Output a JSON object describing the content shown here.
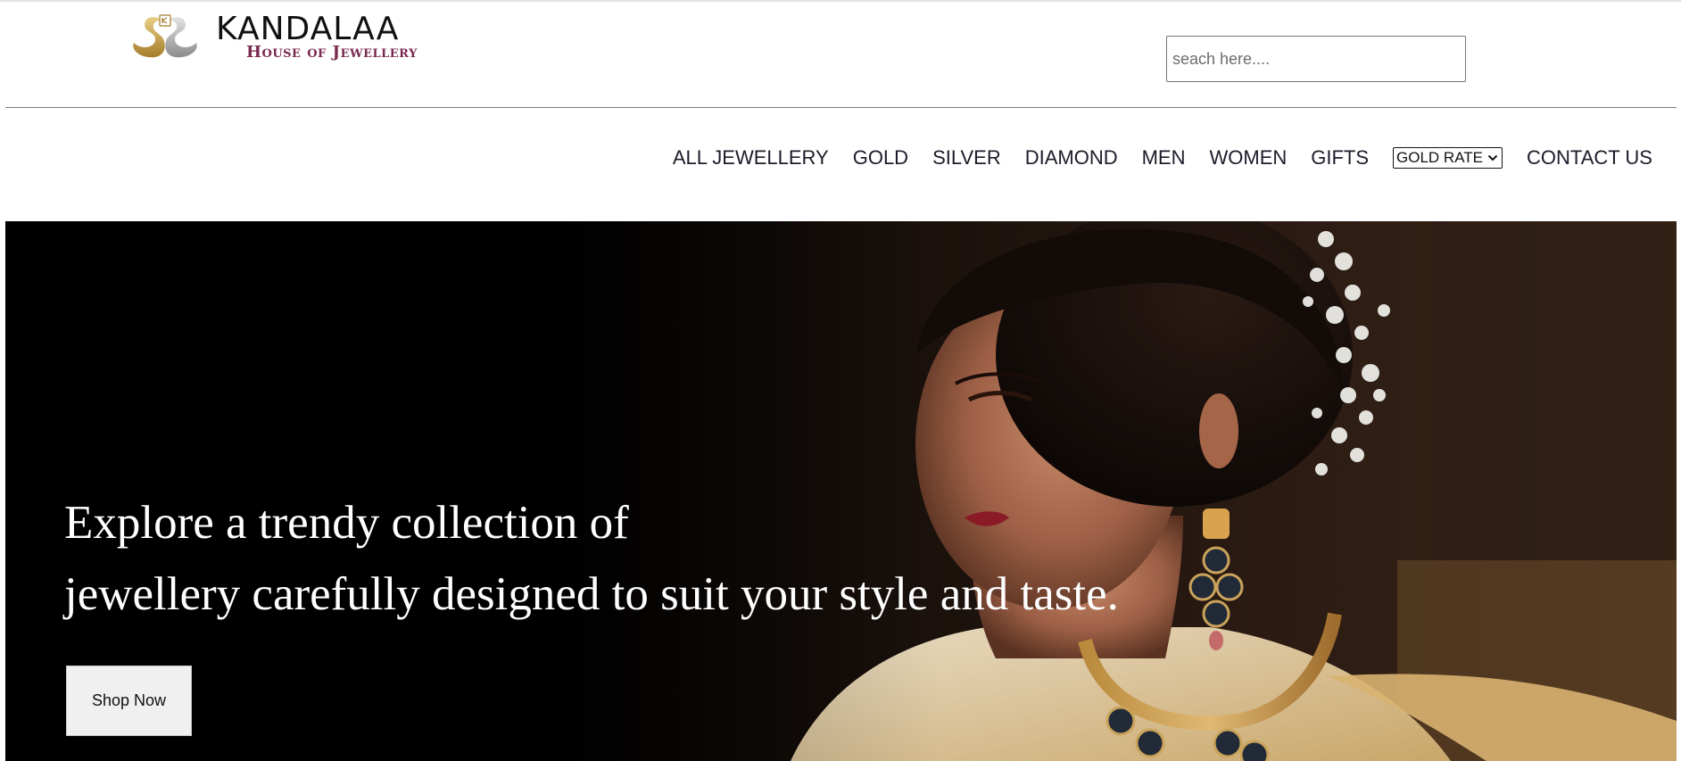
{
  "brand": {
    "name": "KANDALAA",
    "tagline": "House of Jewellery"
  },
  "search": {
    "placeholder": "seach here....",
    "value": ""
  },
  "nav": {
    "items": [
      "ALL JEWELLERY",
      "GOLD",
      "SILVER",
      "DIAMOND",
      "MEN",
      "WOMEN",
      "GIFTS"
    ],
    "gold_rate_label": "GOLD RATE",
    "contact_label": "CONTACT US"
  },
  "hero": {
    "headline_line1": "Explore a trendy collection of",
    "headline_line2": "jewellery carefully designed to suit your style and taste.",
    "cta_label": "Shop Now"
  },
  "colors": {
    "brand_title": "#111111",
    "brand_tagline": "#7a2a50",
    "emblem_gold": "#c9a24a",
    "nav_text": "#1c1c2a",
    "hero_background": "#000000",
    "hero_text": "#ffffff",
    "button_background": "#f0f0f0"
  },
  "icons": {
    "logo": "twin-swan-emblem-icon",
    "dropdown": "chevron-down-icon"
  }
}
